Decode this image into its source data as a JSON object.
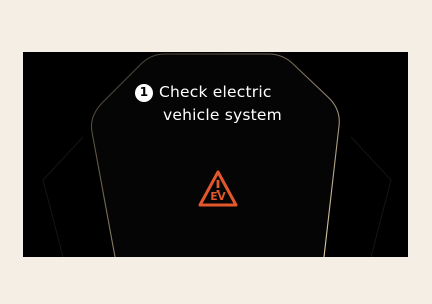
{
  "warning": {
    "number": "1",
    "line1": "Check electric",
    "line2": "vehicle system",
    "icon": "ev-warning-triangle-icon",
    "icon_label": "EV",
    "icon_color": "#e2572b"
  },
  "colors": {
    "page_background": "#f4eee4",
    "screen_background": "#000000",
    "frame_outline": "#b9a98a",
    "text": "#ffffff"
  }
}
